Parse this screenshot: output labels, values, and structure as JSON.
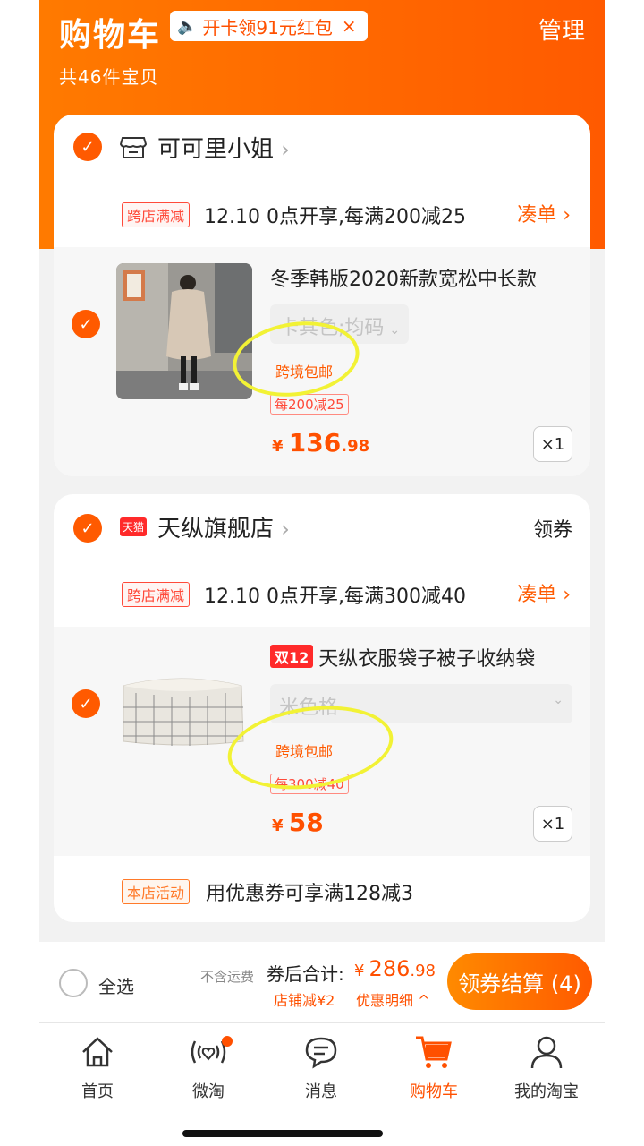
{
  "header": {
    "title": "购物车",
    "promo_text": "开卡领91元红包",
    "promo_close": "×",
    "manage": "管理",
    "count": "共46件宝贝"
  },
  "shops": [
    {
      "name": "可可里小姐",
      "promo_tag": "跨店满减",
      "promo_text": "12.10 0点开享,每满200减25",
      "promo_link": "凑单 ›",
      "item": {
        "title": "冬季韩版2020新款宽松中长款",
        "sku": "卡其色;均码",
        "shipping": "跨境包邮",
        "deal": "每200减25",
        "price_int": "136",
        "price_dec": ".98",
        "qty": "×1"
      }
    },
    {
      "name": "天纵旗舰店",
      "badge": "天猫",
      "coupon": "领券",
      "promo_tag": "跨店满减",
      "promo_text": "12.10 0点开享,每满300减40",
      "promo_link": "凑单 ›",
      "item": {
        "badge": "双12",
        "title": "天纵衣服袋子被子收纳袋",
        "sku": "米色格",
        "shipping": "跨境包邮",
        "deal": "每300减40",
        "price_int": "58",
        "qty": "×1"
      },
      "store_activity_tag": "本店活动",
      "store_activity_text": "用优惠券可享满128减3"
    }
  ],
  "checkout": {
    "select_all": "全选",
    "no_shipping": "不含运费",
    "total_label": "券后合计:",
    "currency": "¥",
    "total_int": "286",
    "total_dec": ".98",
    "discount": "店铺减¥2",
    "discount_detail": "优惠明细 ^",
    "button": "领券结算 (4)"
  },
  "tabs": [
    {
      "label": "首页"
    },
    {
      "label": "微淘"
    },
    {
      "label": "消息"
    },
    {
      "label": "购物车"
    },
    {
      "label": "我的淘宝"
    }
  ],
  "colors": {
    "accent": "#ff5000",
    "highlight_circle": "#f2f235"
  },
  "icons": [
    "speaker-icon",
    "shop-icon",
    "chevron-right-icon",
    "check-icon",
    "home-icon",
    "weitao-icon",
    "message-icon",
    "cart-icon",
    "profile-icon"
  ]
}
